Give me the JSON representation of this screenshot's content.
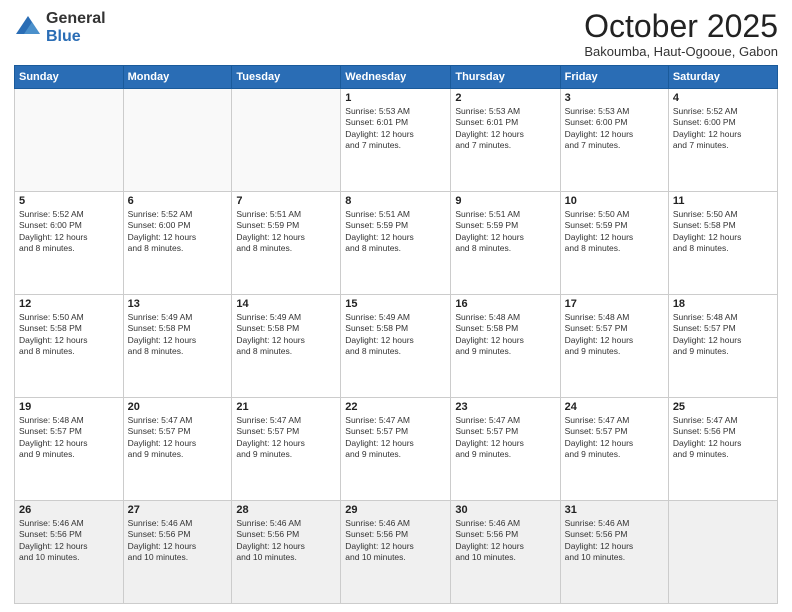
{
  "logo": {
    "general": "General",
    "blue": "Blue"
  },
  "header": {
    "month": "October 2025",
    "location": "Bakoumba, Haut-Ogooue, Gabon"
  },
  "weekdays": [
    "Sunday",
    "Monday",
    "Tuesday",
    "Wednesday",
    "Thursday",
    "Friday",
    "Saturday"
  ],
  "weeks": [
    [
      {
        "day": "",
        "info": ""
      },
      {
        "day": "",
        "info": ""
      },
      {
        "day": "",
        "info": ""
      },
      {
        "day": "1",
        "info": "Sunrise: 5:53 AM\nSunset: 6:01 PM\nDaylight: 12 hours\nand 7 minutes."
      },
      {
        "day": "2",
        "info": "Sunrise: 5:53 AM\nSunset: 6:01 PM\nDaylight: 12 hours\nand 7 minutes."
      },
      {
        "day": "3",
        "info": "Sunrise: 5:53 AM\nSunset: 6:00 PM\nDaylight: 12 hours\nand 7 minutes."
      },
      {
        "day": "4",
        "info": "Sunrise: 5:52 AM\nSunset: 6:00 PM\nDaylight: 12 hours\nand 7 minutes."
      }
    ],
    [
      {
        "day": "5",
        "info": "Sunrise: 5:52 AM\nSunset: 6:00 PM\nDaylight: 12 hours\nand 8 minutes."
      },
      {
        "day": "6",
        "info": "Sunrise: 5:52 AM\nSunset: 6:00 PM\nDaylight: 12 hours\nand 8 minutes."
      },
      {
        "day": "7",
        "info": "Sunrise: 5:51 AM\nSunset: 5:59 PM\nDaylight: 12 hours\nand 8 minutes."
      },
      {
        "day": "8",
        "info": "Sunrise: 5:51 AM\nSunset: 5:59 PM\nDaylight: 12 hours\nand 8 minutes."
      },
      {
        "day": "9",
        "info": "Sunrise: 5:51 AM\nSunset: 5:59 PM\nDaylight: 12 hours\nand 8 minutes."
      },
      {
        "day": "10",
        "info": "Sunrise: 5:50 AM\nSunset: 5:59 PM\nDaylight: 12 hours\nand 8 minutes."
      },
      {
        "day": "11",
        "info": "Sunrise: 5:50 AM\nSunset: 5:58 PM\nDaylight: 12 hours\nand 8 minutes."
      }
    ],
    [
      {
        "day": "12",
        "info": "Sunrise: 5:50 AM\nSunset: 5:58 PM\nDaylight: 12 hours\nand 8 minutes."
      },
      {
        "day": "13",
        "info": "Sunrise: 5:49 AM\nSunset: 5:58 PM\nDaylight: 12 hours\nand 8 minutes."
      },
      {
        "day": "14",
        "info": "Sunrise: 5:49 AM\nSunset: 5:58 PM\nDaylight: 12 hours\nand 8 minutes."
      },
      {
        "day": "15",
        "info": "Sunrise: 5:49 AM\nSunset: 5:58 PM\nDaylight: 12 hours\nand 8 minutes."
      },
      {
        "day": "16",
        "info": "Sunrise: 5:48 AM\nSunset: 5:58 PM\nDaylight: 12 hours\nand 9 minutes."
      },
      {
        "day": "17",
        "info": "Sunrise: 5:48 AM\nSunset: 5:57 PM\nDaylight: 12 hours\nand 9 minutes."
      },
      {
        "day": "18",
        "info": "Sunrise: 5:48 AM\nSunset: 5:57 PM\nDaylight: 12 hours\nand 9 minutes."
      }
    ],
    [
      {
        "day": "19",
        "info": "Sunrise: 5:48 AM\nSunset: 5:57 PM\nDaylight: 12 hours\nand 9 minutes."
      },
      {
        "day": "20",
        "info": "Sunrise: 5:47 AM\nSunset: 5:57 PM\nDaylight: 12 hours\nand 9 minutes."
      },
      {
        "day": "21",
        "info": "Sunrise: 5:47 AM\nSunset: 5:57 PM\nDaylight: 12 hours\nand 9 minutes."
      },
      {
        "day": "22",
        "info": "Sunrise: 5:47 AM\nSunset: 5:57 PM\nDaylight: 12 hours\nand 9 minutes."
      },
      {
        "day": "23",
        "info": "Sunrise: 5:47 AM\nSunset: 5:57 PM\nDaylight: 12 hours\nand 9 minutes."
      },
      {
        "day": "24",
        "info": "Sunrise: 5:47 AM\nSunset: 5:57 PM\nDaylight: 12 hours\nand 9 minutes."
      },
      {
        "day": "25",
        "info": "Sunrise: 5:47 AM\nSunset: 5:56 PM\nDaylight: 12 hours\nand 9 minutes."
      }
    ],
    [
      {
        "day": "26",
        "info": "Sunrise: 5:46 AM\nSunset: 5:56 PM\nDaylight: 12 hours\nand 10 minutes."
      },
      {
        "day": "27",
        "info": "Sunrise: 5:46 AM\nSunset: 5:56 PM\nDaylight: 12 hours\nand 10 minutes."
      },
      {
        "day": "28",
        "info": "Sunrise: 5:46 AM\nSunset: 5:56 PM\nDaylight: 12 hours\nand 10 minutes."
      },
      {
        "day": "29",
        "info": "Sunrise: 5:46 AM\nSunset: 5:56 PM\nDaylight: 12 hours\nand 10 minutes."
      },
      {
        "day": "30",
        "info": "Sunrise: 5:46 AM\nSunset: 5:56 PM\nDaylight: 12 hours\nand 10 minutes."
      },
      {
        "day": "31",
        "info": "Sunrise: 5:46 AM\nSunset: 5:56 PM\nDaylight: 12 hours\nand 10 minutes."
      },
      {
        "day": "",
        "info": ""
      }
    ]
  ]
}
